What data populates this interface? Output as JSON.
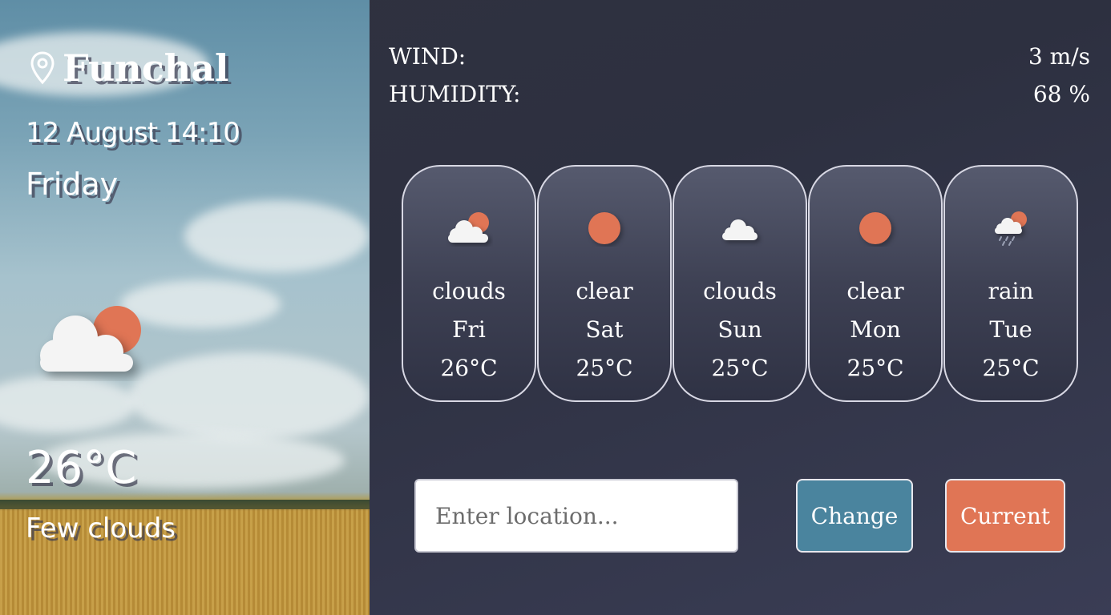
{
  "current": {
    "city": "Funchal",
    "datetime": "12 August 14:10",
    "day": "Friday",
    "temperature": "26°C",
    "description": "Few clouds",
    "icon": "sun-behind-cloud-icon"
  },
  "stats": {
    "wind_label": "WIND:",
    "wind_value": "3 m/s",
    "humidity_label": "HUMIDITY:",
    "humidity_value": "68 %"
  },
  "forecast": [
    {
      "desc": "clouds",
      "day": "Fri",
      "temp": "26°C",
      "icon": "sun-behind-cloud-icon"
    },
    {
      "desc": "clear",
      "day": "Sat",
      "temp": "25°C",
      "icon": "sun-icon"
    },
    {
      "desc": "clouds",
      "day": "Sun",
      "temp": "25°C",
      "icon": "cloud-icon"
    },
    {
      "desc": "clear",
      "day": "Mon",
      "temp": "25°C",
      "icon": "sun-icon"
    },
    {
      "desc": "rain",
      "day": "Tue",
      "temp": "25°C",
      "icon": "rain-cloud-sun-icon"
    }
  ],
  "search": {
    "placeholder": "Enter location...",
    "value": ""
  },
  "buttons": {
    "change_label": "Change",
    "current_label": "Current"
  },
  "colors": {
    "sun": "#e07555",
    "cloud": "#f4f4f4",
    "change_button": "#4a849e",
    "current_button": "#e07555"
  }
}
